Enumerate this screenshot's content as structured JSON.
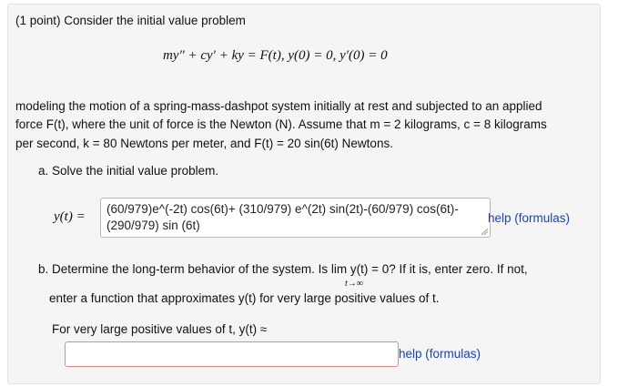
{
  "problem": {
    "intro": "(1 point) Consider the initial value problem",
    "equation": "my″ + cy′ + ky = F(t),    y(0) = 0,   y′(0) = 0",
    "description_line1": "modeling the motion of a spring-mass-dashpot system initially at rest and subjected to an applied",
    "description_line2": "force F(t), where the unit of force is the Newton (N). Assume that m = 2 kilograms, c = 8 kilograms",
    "description_line3": "per second, k = 80 Newtons per meter, and F(t) = 20 sin(6t) Newtons."
  },
  "part_a": {
    "prompt": "a. Solve the initial value problem.",
    "label": "y(t) =",
    "answer": "(60/979)e^(-2t) cos(6t)+ (310/979) e^(2t) sin(2t)-(60/979) cos(6t)-(290/979) sin (6t)",
    "help": "help (formulas)"
  },
  "part_b": {
    "prompt_line1": "b. Determine the long-term behavior of the system. Is lim y(t) = 0? If it is, enter zero. If not,",
    "limit_sub": "t→∞",
    "prompt_line2": "enter a function that approximates y(t) for very large positive values of t.",
    "label": "For very large positive values of t, y(t) ≈",
    "answer": "",
    "help": "help (formulas)"
  }
}
